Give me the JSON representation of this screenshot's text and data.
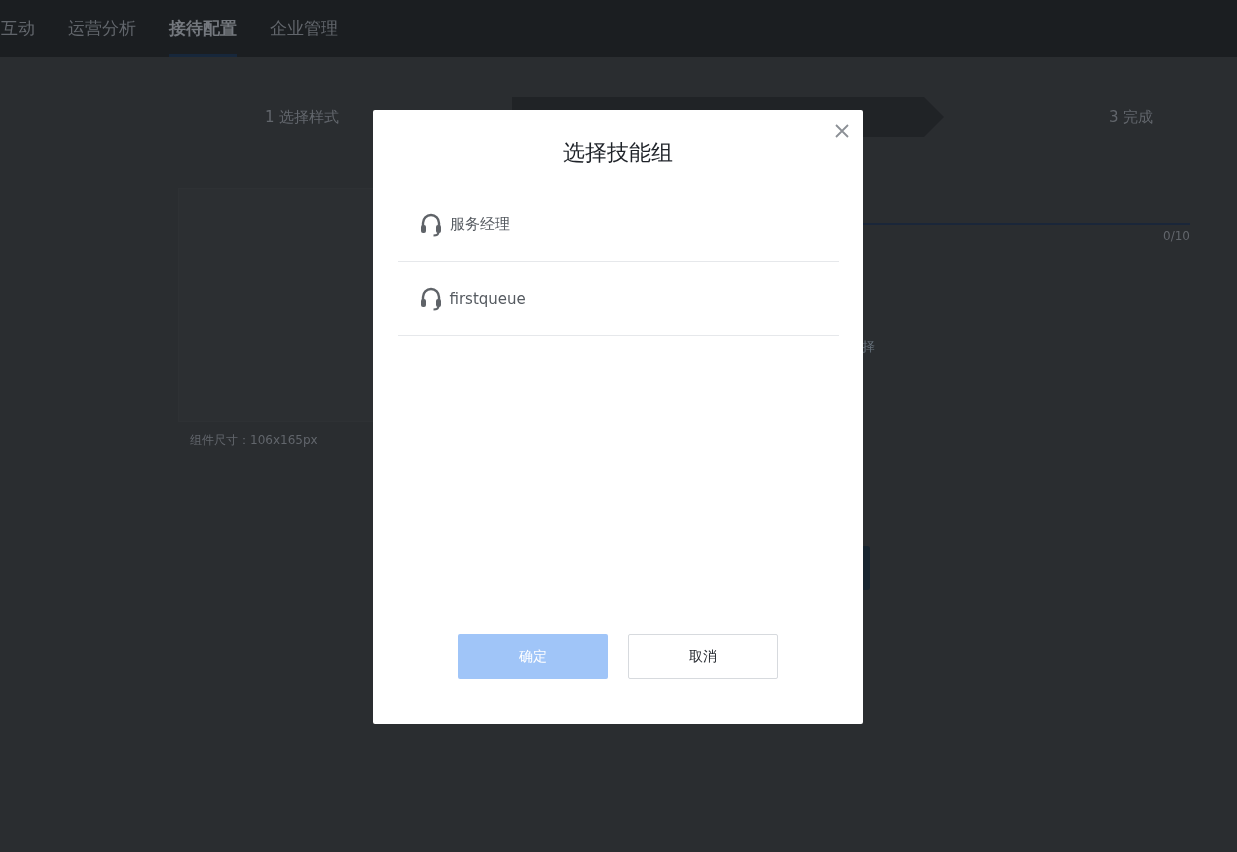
{
  "nav": {
    "items": [
      {
        "label": "互动",
        "selected": false
      },
      {
        "label": "运营分析",
        "selected": false
      },
      {
        "label": "接待配置",
        "selected": true
      },
      {
        "label": "企业管理",
        "selected": false
      }
    ]
  },
  "steps": [
    {
      "label": "1 选择样式",
      "selected": false
    },
    {
      "selected": true
    },
    {
      "label": "3 完成",
      "selected": false
    }
  ],
  "component_size": "组件尺寸：106x165px",
  "counter": "0/10",
  "partial_label": "择",
  "dialog": {
    "title": "选择技能组",
    "items": [
      {
        "label": "服务经理",
        "selected": false
      },
      {
        "label": "firstqueue",
        "selected": false
      }
    ],
    "confirm": {
      "label": "确定",
      "disabled": true
    },
    "cancel": {
      "label": "取消"
    }
  }
}
